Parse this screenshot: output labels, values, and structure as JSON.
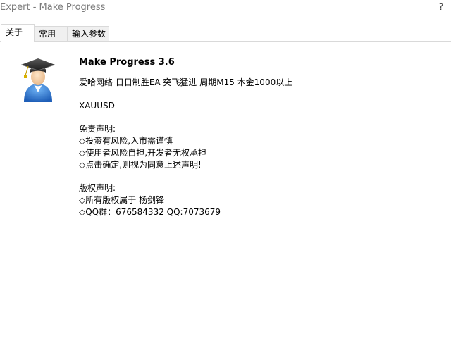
{
  "window": {
    "title": "Expert - Make Progress",
    "help_label": "?"
  },
  "tabs": [
    {
      "label": "关于",
      "active": true
    },
    {
      "label": "常用",
      "active": false
    },
    {
      "label": "输入参数",
      "active": false
    }
  ],
  "about": {
    "icon": "graduate-user-icon",
    "title": "Make Progress 3.6",
    "description": "爱哈网络 日日制胜EA 突飞猛进 周期M15 本金1000以上",
    "symbol": "XAUUSD",
    "disclaimer": {
      "heading": "免责声明:",
      "lines": [
        "◇投资有风险,入市需谨慎",
        "◇使用者风险自担,开发者无权承担",
        "◇点击确定,则视为同意上述声明!"
      ]
    },
    "copyright": {
      "heading": "版权声明:",
      "lines": [
        "◇所有版权属于 杨剑锋",
        "◇QQ群：676584332 QQ:7073679"
      ]
    }
  },
  "colors": {
    "title_text": "#7a7a7a",
    "tab_border": "#d9d9d9",
    "tab_inactive_bg": "#f0f0f0",
    "icon_blue": "#2f7fd8"
  }
}
